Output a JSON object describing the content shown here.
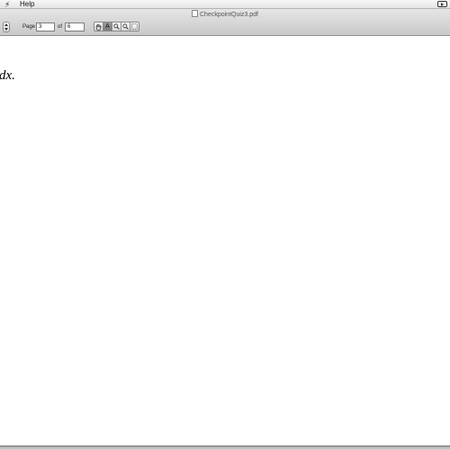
{
  "menubar": {
    "script_icon": "script-menu-icon",
    "help_label": "Help",
    "tray_icon": "forward-tray-icon"
  },
  "window": {
    "title": "CheckpointQuiz3.pdf",
    "title_icon": "pdf-document-icon"
  },
  "toolbar": {
    "page_label": "Page",
    "page_value": "3",
    "of_label": "of",
    "total_pages": "6",
    "tools": [
      {
        "name": "hand-tool-icon",
        "active": false
      },
      {
        "name": "text-select-tool-icon",
        "label": "A",
        "active": true
      },
      {
        "name": "zoom-in-icon",
        "active": false
      },
      {
        "name": "zoom-out-icon",
        "active": false
      },
      {
        "name": "select-rectangle-icon",
        "active": false
      }
    ],
    "active_color": "#8a8a8a"
  },
  "document": {
    "visible_text": "dx."
  }
}
